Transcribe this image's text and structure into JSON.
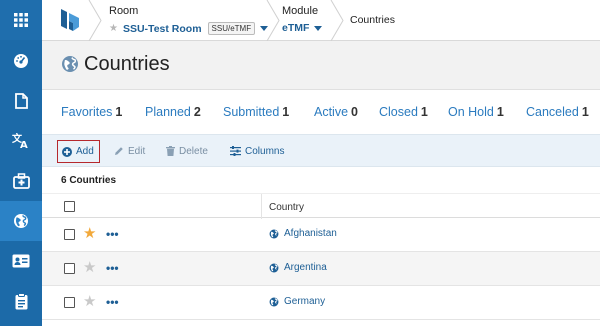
{
  "nav": {
    "items": [
      {
        "name": "dashboard-icon"
      },
      {
        "name": "document-icon"
      },
      {
        "name": "translate-icon"
      },
      {
        "name": "hospital-icon"
      },
      {
        "name": "globe-icon",
        "active": true
      },
      {
        "name": "id-card-icon"
      },
      {
        "name": "clipboard-icon"
      }
    ]
  },
  "header": {
    "room_label": "Room",
    "room_value": "SSU-Test Room",
    "room_badge": "SSU/eTMF",
    "module_label": "Module",
    "module_value": "eTMF",
    "current": "Countries"
  },
  "page": {
    "title": "Countries"
  },
  "tabs": [
    {
      "label": "Favorites",
      "count": "1"
    },
    {
      "label": "Planned",
      "count": "2"
    },
    {
      "label": "Submitted",
      "count": "1"
    },
    {
      "label": "Active",
      "count": "0"
    },
    {
      "label": "Closed",
      "count": "1"
    },
    {
      "label": "On Hold",
      "count": "1"
    },
    {
      "label": "Canceled",
      "count": "1"
    }
  ],
  "toolbar": {
    "add": "Add",
    "edit": "Edit",
    "delete": "Delete",
    "columns": "Columns"
  },
  "table": {
    "count_label": "6 Countries",
    "header_country": "Country",
    "row_menu": "•••",
    "rows": [
      {
        "country": "Afghanistan",
        "favorite": true
      },
      {
        "country": "Argentina",
        "favorite": false
      },
      {
        "country": "Germany",
        "favorite": false
      }
    ]
  },
  "colors": {
    "rail": "#1c6aa8",
    "accent": "#2b7bbf",
    "add_outline": "#b6282d",
    "star": "#f2a93b"
  }
}
